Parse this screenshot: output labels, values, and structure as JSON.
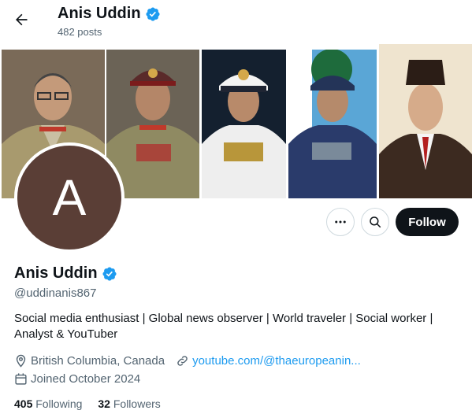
{
  "header": {
    "name": "Anis Uddin",
    "posts": "482 posts",
    "back_icon": "arrow-left-icon"
  },
  "profile": {
    "avatar_letter": "A",
    "avatar_color": "#5a3e36",
    "name": "Anis Uddin",
    "verified_icon": "verified-badge-icon",
    "handle": "@uddinanis867",
    "bio": "Social media enthusiast | Global news observer | World traveler | Social worker | Analyst & YouTuber",
    "location": "British Columbia, Canada",
    "website": "youtube.com/@thaeuropeanin...",
    "joined": "Joined October 2024",
    "following_count": "405",
    "following_label": "Following",
    "followers_count": "32",
    "followers_label": "Followers"
  },
  "actions": {
    "more_icon": "more-icon",
    "search_icon": "search-icon",
    "follow_label": "Follow"
  },
  "colors": {
    "accent": "#1d9bf0",
    "text": "#0f1419",
    "muted": "#536471"
  }
}
